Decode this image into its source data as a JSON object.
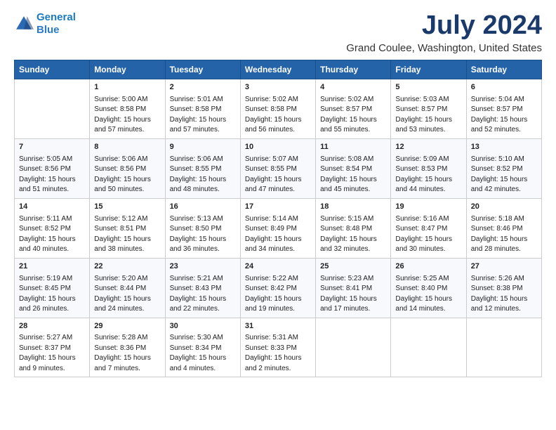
{
  "logo": {
    "line1": "General",
    "line2": "Blue"
  },
  "title": "July 2024",
  "location": "Grand Coulee, Washington, United States",
  "days_of_week": [
    "Sunday",
    "Monday",
    "Tuesday",
    "Wednesday",
    "Thursday",
    "Friday",
    "Saturday"
  ],
  "weeks": [
    [
      {
        "day": "",
        "info": ""
      },
      {
        "day": "1",
        "info": "Sunrise: 5:00 AM\nSunset: 8:58 PM\nDaylight: 15 hours\nand 57 minutes."
      },
      {
        "day": "2",
        "info": "Sunrise: 5:01 AM\nSunset: 8:58 PM\nDaylight: 15 hours\nand 57 minutes."
      },
      {
        "day": "3",
        "info": "Sunrise: 5:02 AM\nSunset: 8:58 PM\nDaylight: 15 hours\nand 56 minutes."
      },
      {
        "day": "4",
        "info": "Sunrise: 5:02 AM\nSunset: 8:57 PM\nDaylight: 15 hours\nand 55 minutes."
      },
      {
        "day": "5",
        "info": "Sunrise: 5:03 AM\nSunset: 8:57 PM\nDaylight: 15 hours\nand 53 minutes."
      },
      {
        "day": "6",
        "info": "Sunrise: 5:04 AM\nSunset: 8:57 PM\nDaylight: 15 hours\nand 52 minutes."
      }
    ],
    [
      {
        "day": "7",
        "info": "Sunrise: 5:05 AM\nSunset: 8:56 PM\nDaylight: 15 hours\nand 51 minutes."
      },
      {
        "day": "8",
        "info": "Sunrise: 5:06 AM\nSunset: 8:56 PM\nDaylight: 15 hours\nand 50 minutes."
      },
      {
        "day": "9",
        "info": "Sunrise: 5:06 AM\nSunset: 8:55 PM\nDaylight: 15 hours\nand 48 minutes."
      },
      {
        "day": "10",
        "info": "Sunrise: 5:07 AM\nSunset: 8:55 PM\nDaylight: 15 hours\nand 47 minutes."
      },
      {
        "day": "11",
        "info": "Sunrise: 5:08 AM\nSunset: 8:54 PM\nDaylight: 15 hours\nand 45 minutes."
      },
      {
        "day": "12",
        "info": "Sunrise: 5:09 AM\nSunset: 8:53 PM\nDaylight: 15 hours\nand 44 minutes."
      },
      {
        "day": "13",
        "info": "Sunrise: 5:10 AM\nSunset: 8:52 PM\nDaylight: 15 hours\nand 42 minutes."
      }
    ],
    [
      {
        "day": "14",
        "info": "Sunrise: 5:11 AM\nSunset: 8:52 PM\nDaylight: 15 hours\nand 40 minutes."
      },
      {
        "day": "15",
        "info": "Sunrise: 5:12 AM\nSunset: 8:51 PM\nDaylight: 15 hours\nand 38 minutes."
      },
      {
        "day": "16",
        "info": "Sunrise: 5:13 AM\nSunset: 8:50 PM\nDaylight: 15 hours\nand 36 minutes."
      },
      {
        "day": "17",
        "info": "Sunrise: 5:14 AM\nSunset: 8:49 PM\nDaylight: 15 hours\nand 34 minutes."
      },
      {
        "day": "18",
        "info": "Sunrise: 5:15 AM\nSunset: 8:48 PM\nDaylight: 15 hours\nand 32 minutes."
      },
      {
        "day": "19",
        "info": "Sunrise: 5:16 AM\nSunset: 8:47 PM\nDaylight: 15 hours\nand 30 minutes."
      },
      {
        "day": "20",
        "info": "Sunrise: 5:18 AM\nSunset: 8:46 PM\nDaylight: 15 hours\nand 28 minutes."
      }
    ],
    [
      {
        "day": "21",
        "info": "Sunrise: 5:19 AM\nSunset: 8:45 PM\nDaylight: 15 hours\nand 26 minutes."
      },
      {
        "day": "22",
        "info": "Sunrise: 5:20 AM\nSunset: 8:44 PM\nDaylight: 15 hours\nand 24 minutes."
      },
      {
        "day": "23",
        "info": "Sunrise: 5:21 AM\nSunset: 8:43 PM\nDaylight: 15 hours\nand 22 minutes."
      },
      {
        "day": "24",
        "info": "Sunrise: 5:22 AM\nSunset: 8:42 PM\nDaylight: 15 hours\nand 19 minutes."
      },
      {
        "day": "25",
        "info": "Sunrise: 5:23 AM\nSunset: 8:41 PM\nDaylight: 15 hours\nand 17 minutes."
      },
      {
        "day": "26",
        "info": "Sunrise: 5:25 AM\nSunset: 8:40 PM\nDaylight: 15 hours\nand 14 minutes."
      },
      {
        "day": "27",
        "info": "Sunrise: 5:26 AM\nSunset: 8:38 PM\nDaylight: 15 hours\nand 12 minutes."
      }
    ],
    [
      {
        "day": "28",
        "info": "Sunrise: 5:27 AM\nSunset: 8:37 PM\nDaylight: 15 hours\nand 9 minutes."
      },
      {
        "day": "29",
        "info": "Sunrise: 5:28 AM\nSunset: 8:36 PM\nDaylight: 15 hours\nand 7 minutes."
      },
      {
        "day": "30",
        "info": "Sunrise: 5:30 AM\nSunset: 8:34 PM\nDaylight: 15 hours\nand 4 minutes."
      },
      {
        "day": "31",
        "info": "Sunrise: 5:31 AM\nSunset: 8:33 PM\nDaylight: 15 hours\nand 2 minutes."
      },
      {
        "day": "",
        "info": ""
      },
      {
        "day": "",
        "info": ""
      },
      {
        "day": "",
        "info": ""
      }
    ]
  ]
}
